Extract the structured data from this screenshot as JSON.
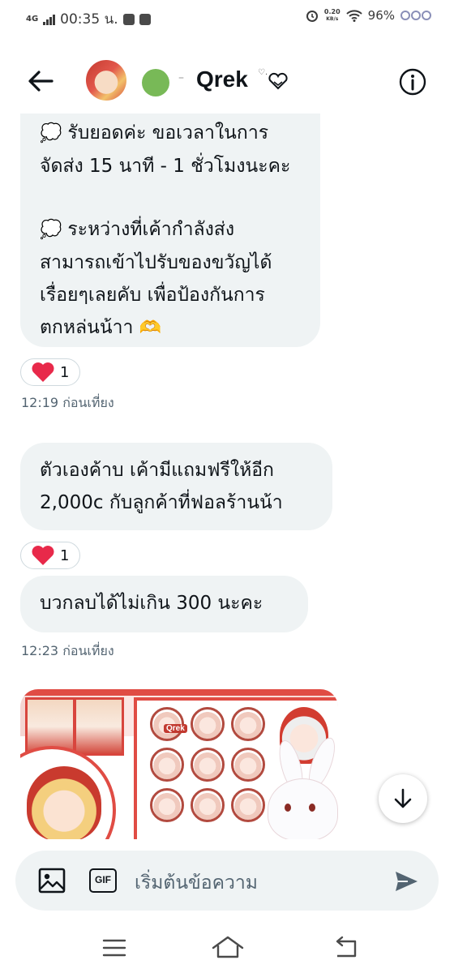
{
  "status_bar": {
    "network": "4G",
    "time": "00:35 น.",
    "speed_value": "0.20",
    "speed_unit": "KB/s",
    "battery": "96%"
  },
  "header": {
    "title": "Qrek",
    "dash": "–",
    "heart_symbol": "♡."
  },
  "messages": [
    {
      "lines_a": [
        "รับยอดค่ะ ขอเวลาในการ",
        "จัดส่ง 15 นาที - 1 ชั่วโมงนะคะ"
      ],
      "lines_b": [
        "ระหว่างที่เค้ากำลังส่ง",
        "สามารถเข้าไปรับของขวัญได้",
        "เรื่อยๆเลยคับ เพื่อป้องกันการ",
        "ตกหล่นน้าา"
      ],
      "reaction_count": "1",
      "timestamp": "12:19 ก่อนเที่ยง"
    },
    {
      "lines": [
        "ตัวเองค้าบ เค้ามีแถมฟรีให้อีก",
        "2,000c กับลูกค้าที่ฟอลร้านน้า"
      ],
      "reaction_count": "1"
    },
    {
      "lines": [
        "บวกลบได้ไม่เกิน 300 นะคะ"
      ],
      "timestamp": "12:23 ก่อนเที่ยง"
    }
  ],
  "media": {
    "badge_label": "Qrek"
  },
  "composer": {
    "placeholder": "เริ่มต้นข้อความ",
    "gif_label": "GIF"
  },
  "colors": {
    "bubble": "#eff3f4",
    "heart": "#f91880",
    "presence": "#78b957",
    "send": "#536471"
  },
  "icons": [
    "back-arrow-icon",
    "info-icon",
    "speech-bubble-icon",
    "heart-hands-icon",
    "heart-icon",
    "arrow-down-icon",
    "image-icon",
    "gif-icon",
    "send-icon",
    "menu-icon",
    "home-icon",
    "back-icon"
  ]
}
